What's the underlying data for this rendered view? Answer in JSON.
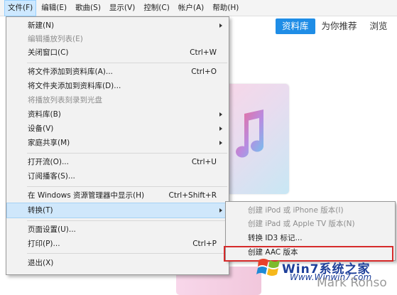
{
  "menubar": {
    "items": [
      {
        "label": "文件(F)",
        "active": true
      },
      {
        "label": "编辑(E)"
      },
      {
        "label": "歌曲(S)"
      },
      {
        "label": "显示(V)"
      },
      {
        "label": "控制(C)"
      },
      {
        "label": "帐户(A)"
      },
      {
        "label": "帮助(H)"
      }
    ]
  },
  "library_tabs": [
    "资料库",
    "为你推荐",
    "浏览"
  ],
  "file_menu": {
    "items": [
      {
        "label": "新建(N)",
        "shortcut": "",
        "submenu": true,
        "disabled": false
      },
      {
        "label": "编辑播放列表(E)",
        "shortcut": "",
        "submenu": false,
        "disabled": true
      },
      {
        "label": "关闭窗口(C)",
        "shortcut": "Ctrl+W",
        "submenu": false,
        "disabled": false
      },
      {
        "label": "将文件添加到资料库(A)...",
        "shortcut": "Ctrl+O",
        "submenu": false,
        "disabled": false
      },
      {
        "label": "将文件夹添加到资料库(D)...",
        "shortcut": "",
        "submenu": false,
        "disabled": false
      },
      {
        "label": "将播放列表刻录到光盘",
        "shortcut": "",
        "submenu": false,
        "disabled": true
      },
      {
        "label": "资料库(B)",
        "shortcut": "",
        "submenu": true,
        "disabled": false
      },
      {
        "label": "设备(V)",
        "shortcut": "",
        "submenu": true,
        "disabled": false
      },
      {
        "label": "家庭共享(M)",
        "shortcut": "",
        "submenu": true,
        "disabled": false
      },
      {
        "label": "打开流(O)...",
        "shortcut": "Ctrl+U",
        "submenu": false,
        "disabled": false
      },
      {
        "label": "订阅播客(S)...",
        "shortcut": "",
        "submenu": false,
        "disabled": false
      },
      {
        "label": "在 Windows 资源管理器中显示(H)",
        "shortcut": "Ctrl+Shift+R",
        "submenu": false,
        "disabled": false
      },
      {
        "label": "转换(T)",
        "shortcut": "",
        "submenu": true,
        "disabled": false,
        "highlighted": true
      },
      {
        "label": "页面设置(U)...",
        "shortcut": "",
        "submenu": false,
        "disabled": false
      },
      {
        "label": "打印(P)...",
        "shortcut": "Ctrl+P",
        "submenu": false,
        "disabled": false
      },
      {
        "label": "退出(X)",
        "shortcut": "",
        "submenu": false,
        "disabled": false
      }
    ]
  },
  "convert_submenu": {
    "items": [
      {
        "label": "创建 iPod 或 iPhone 版本(I)",
        "disabled": true
      },
      {
        "label": "创建 iPad 或 Apple TV 版本(N)",
        "disabled": true
      },
      {
        "label": "转换 ID3 标记...",
        "disabled": false
      },
      {
        "label": "创建 AAC 版本",
        "disabled": false,
        "emphasized": true
      }
    ]
  },
  "watermark": {
    "brand": "Win7系统之家",
    "url": "Www.Winwin7.com"
  },
  "artist_text": "Mark Ronso",
  "colors": {
    "accent": "#1f8de6",
    "menu_highlight": "#cfe7fb",
    "focus_box": "#d62b2b",
    "disabled_text": "#8d8d8d"
  }
}
